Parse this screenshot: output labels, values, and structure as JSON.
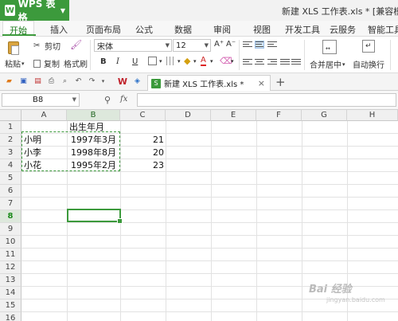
{
  "app": {
    "name": "WPS 表格",
    "logo_glyph": "W",
    "title": "新建 XLS 工作表.xls * [兼容模式"
  },
  "menu": {
    "tabs": [
      "开始",
      "插入",
      "页面布局",
      "公式",
      "数据",
      "审阅",
      "视图",
      "开发工具",
      "云服务",
      "智能工具"
    ],
    "active": "开始"
  },
  "ribbon": {
    "paste": "粘贴",
    "cut": "剪切",
    "copy": "复制",
    "format_painter": "格式刷",
    "font_name": "宋体",
    "font_size": "12",
    "merge_center": "合并居中",
    "wrap_text": "自动换行",
    "bold": "B",
    "italic": "I",
    "underline": "U",
    "font_color_sample": "A",
    "grow_font": "A⁺",
    "shrink_font": "A⁻"
  },
  "doc_tab": {
    "label": "新建 XLS 工作表.xls *"
  },
  "formula_bar": {
    "cell_ref": "B8",
    "fx_label": "fx",
    "content": ""
  },
  "sheet": {
    "columns": [
      "A",
      "B",
      "C",
      "D",
      "E",
      "F",
      "G",
      "H"
    ],
    "rows": [
      "1",
      "2",
      "3",
      "4",
      "5",
      "6",
      "7",
      "8",
      "9",
      "10",
      "11",
      "12",
      "13",
      "14",
      "15",
      "16"
    ],
    "selected_cell": "B8",
    "cells": {
      "B1": "出生年月",
      "A2": "小明",
      "B2": "1997年3月",
      "C2": "21",
      "A3": "小李",
      "B3": "1998年8月",
      "C3": "20",
      "A4": "小花",
      "B4": "1995年2月",
      "C4": "23"
    }
  },
  "watermark": {
    "text": "Bai 经验",
    "sub": "jingyan.baidu.com"
  },
  "colors": {
    "accent": "#3c9a3c",
    "header_bg": "#f0f0f0",
    "grid_line": "#e2e2e2"
  }
}
